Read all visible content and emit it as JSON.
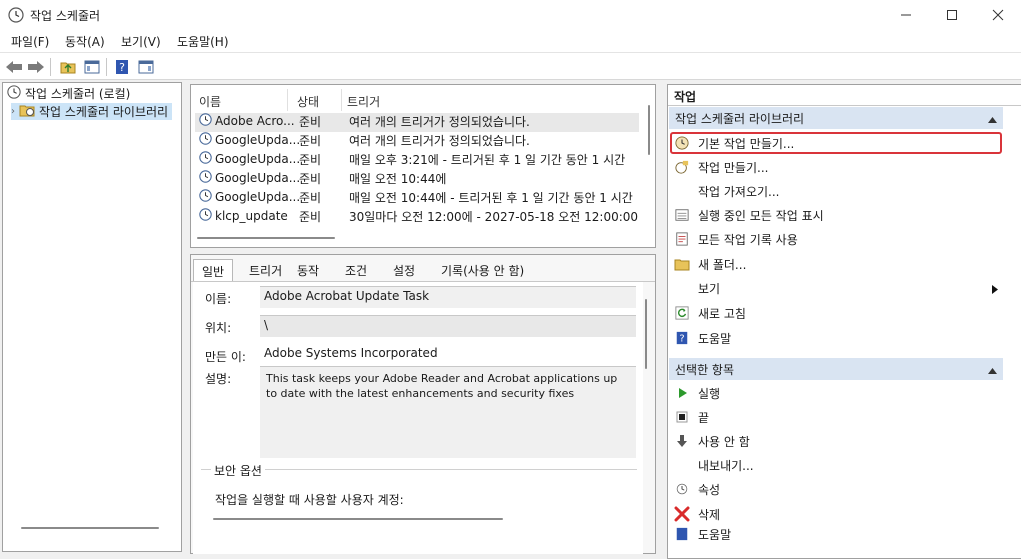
{
  "window": {
    "title": "작업 스케줄러"
  },
  "menu": [
    "파일(F)",
    "동작(A)",
    "보기(V)",
    "도움말(H)"
  ],
  "tree": {
    "root": "작업 스케줄러 (로컬)",
    "child": "작업 스케줄러 라이브러리"
  },
  "task_list": {
    "columns": [
      "이름",
      "상태",
      "트리거"
    ],
    "rows": [
      {
        "name": "Adobe Acro...",
        "status": "준비",
        "trigger": "여러 개의 트리거가 정의되었습니다."
      },
      {
        "name": "GoogleUpda...",
        "status": "준비",
        "trigger": "여러 개의 트리거가 정의되었습니다."
      },
      {
        "name": "GoogleUpda...",
        "status": "준비",
        "trigger": "매일 오후 3:21에 - 트리거된 후 1 일 기간 동안 1 시간"
      },
      {
        "name": "GoogleUpda...",
        "status": "준비",
        "trigger": "매일 오전 10:44에"
      },
      {
        "name": "GoogleUpda...",
        "status": "준비",
        "trigger": "매일 오전 10:44에 - 트리거된 후 1 일 기간 동안 1 시간"
      },
      {
        "name": "klcp_update",
        "status": "준비",
        "trigger": "30일마다 오전 12:00에 - 2027-05-18 오전 12:00:00"
      }
    ]
  },
  "detail": {
    "tabs": [
      "일반",
      "트리거",
      "동작",
      "조건",
      "설정",
      "기록(사용 안 함)"
    ],
    "name_label": "이름:",
    "name_value": "Adobe Acrobat Update Task",
    "location_label": "위치:",
    "location_value": "\\",
    "author_label": "만든 이:",
    "author_value": "Adobe Systems Incorporated",
    "desc_label": "설명:",
    "desc_value": "This task keeps your Adobe Reader and Acrobat applications up to date with the latest enhancements and security fixes",
    "security_group": "보안 옵션",
    "security_text": "작업을 실행할 때 사용할 사용자 계정:"
  },
  "actions": {
    "title": "작업",
    "section1": "작업 스케줄러 라이브러리",
    "items1": [
      "기본 작업 만들기...",
      "작업 만들기...",
      "작업 가져오기...",
      "실행 중인 모든 작업 표시",
      "모든 작업 기록 사용",
      "새 폴더...",
      "보기",
      "새로 고침",
      "도움말"
    ],
    "section2": "선택한 항목",
    "items2": [
      "실행",
      "끝",
      "사용 안 함",
      "내보내기...",
      "속성",
      "삭제",
      "도움말"
    ],
    "highlight_color": "#d9343a"
  }
}
